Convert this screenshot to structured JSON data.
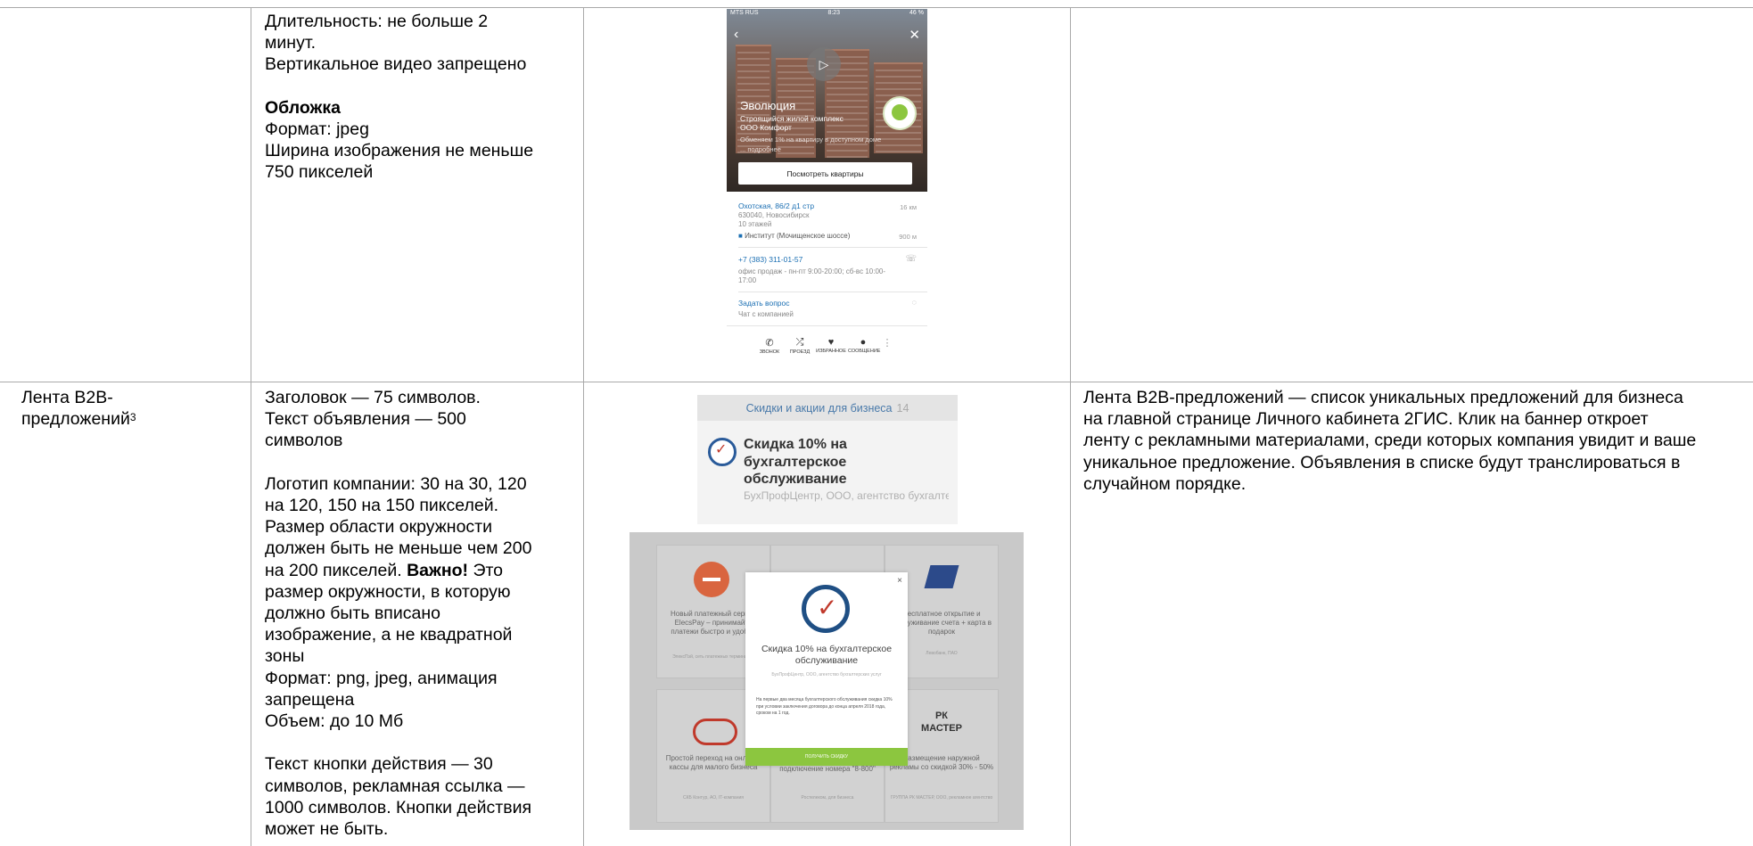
{
  "row1": {
    "col2_lines": [
      {
        "text": "Длительность: не больше 2",
        "bold": false
      },
      {
        "text": "минут.",
        "bold": false
      },
      {
        "text": "Вертикальное видео запрещено",
        "bold": false
      },
      {
        "text": "",
        "bold": false
      },
      {
        "text": "Обложка",
        "bold": true
      },
      {
        "text": "Формат: jpeg",
        "bold": false
      },
      {
        "text": "Ширина изображения не меньше",
        "bold": false
      },
      {
        "text": "750 пикселей",
        "bold": false
      }
    ],
    "phone": {
      "status_carrier": "MTS RUS",
      "status_time": "8:23",
      "status_battery": "46 %",
      "project_name": "Эволюция",
      "project_type": "Строящийся жилой комплекс",
      "project_company": "ООО Комфорт",
      "project_note": "Обменяем 1% на квартиру в доступном доме",
      "project_more": "... подробнее",
      "cta_label": "Посмотреть квартиры",
      "address": "Охотская, 86/2 д1 стр",
      "address_distance": "16 км",
      "postcode_city": "630040, Новосибирск",
      "floors": "10 этажей",
      "stop": "Институт (Мочищенское шоссе)",
      "stop_distance": "900 м",
      "phone_number": "+7 (383) 311-01-57",
      "phone_hours": "офис продаж - пн-пт 9:00-20:00; сб-вс 10:00-17:00",
      "ask_label": "Задать вопрос",
      "ask_sub": "Чат с компанией",
      "tabs": [
        "ЗВОНОК",
        "ПРОЕЗД",
        "ИЗБРАННОЕ",
        "СООБЩЕНИЕ"
      ]
    }
  },
  "row2": {
    "col1_title": "Лента B2B-",
    "col1_title2": "предложений",
    "col1_sup": "3",
    "col2_lines": [
      {
        "text": "Заголовок — 75 символов.",
        "bold": false
      },
      {
        "text": "Текст объявления — 500",
        "bold": false
      },
      {
        "text": "символов",
        "bold": false
      },
      {
        "text": "",
        "bold": false
      },
      {
        "text": "Логотип компании: 30 на 30, 120",
        "bold": false
      },
      {
        "text": "на 120, 150 на 150 пикселей.",
        "bold": false
      },
      {
        "text": "Размер области окружности",
        "bold": false
      },
      {
        "text": "должен быть не меньше чем 200",
        "bold": false
      },
      {
        "text": "на 200 пикселей. ",
        "bold": false,
        "bold_tail": "Важно!",
        "tail": " Это"
      },
      {
        "text": "размер окружности, в которую",
        "bold": false
      },
      {
        "text": "должно быть вписано",
        "bold": false
      },
      {
        "text": "изображение, а не квадратной",
        "bold": false
      },
      {
        "text": "зоны",
        "bold": false
      },
      {
        "text": "Формат: png, jpeg, анимация",
        "bold": false
      },
      {
        "text": "запрещена",
        "bold": false
      },
      {
        "text": "Объем: до 10 Мб",
        "bold": false
      },
      {
        "text": "",
        "bold": false
      },
      {
        "text": "Текст кнопки действия — 30",
        "bold": false
      },
      {
        "text": "символов, рекламная ссылка —",
        "bold": false
      },
      {
        "text": "1000 символов. Кнопки действия",
        "bold": false
      },
      {
        "text": "может не быть.",
        "bold": false
      }
    ],
    "col4_lines": [
      "Лента B2B-предложений — список уникальных предложений для бизнеса",
      "на главной странице Личного кабинета 2ГИС. Клик на баннер откроет",
      "ленту с рекламными материалами, среди которых компания увидит и ваше",
      "уникальное предложение. Объявления в списке будут транслироваться в",
      "случайном порядке."
    ],
    "card": {
      "header": "Скидки и акции для бизнеса",
      "count": "14",
      "title": "Скидка 10% на бухгалтерское обслуживание",
      "subtitle": "БухПрофЦентр, ООО, агентство бухгалтерских услуг"
    },
    "grid": {
      "cells": [
        {
          "text": "Новый платежный сервис ElecsPay – принимайте платежи быстро и удобно",
          "small": "ЭлексПэй, сеть платежных терминалов"
        },
        {
          "text": "",
          "small": ""
        },
        {
          "text": "Бесплатное открытие и обслуживание счета + карта в подарок",
          "small": "Левобанк, ПАО"
        },
        {
          "text": "Простой переход на онлайн-кассы для малого бизнеса",
          "small": "СКБ Контур, АО, IT-компания"
        },
        {
          "text": "подключение номера \"8-800\"",
          "small": "Ростелеком, для бизнеса"
        },
        {
          "text": "Размещение наружной рекламы со скидкой 30% - 50%",
          "small": "ГРУППА РК МАСТЕР, ООО, рекламное агентство"
        }
      ],
      "pk_logo": "РК МАСТЕР",
      "modal": {
        "close": "×",
        "title": "Скидка 10% на бухгалтерское обслуживание",
        "subtitle": "БухПрофЦентр, ООО, агентство бухгалтерских услуг",
        "body": "На первые два месяца бухгалтерского обслуживания скидка 10% при условии заключения договора до конца апреля 2018 года, сроком на 1 год.",
        "button": "ПОЛУЧИТЬ СКИДКУ"
      }
    }
  }
}
